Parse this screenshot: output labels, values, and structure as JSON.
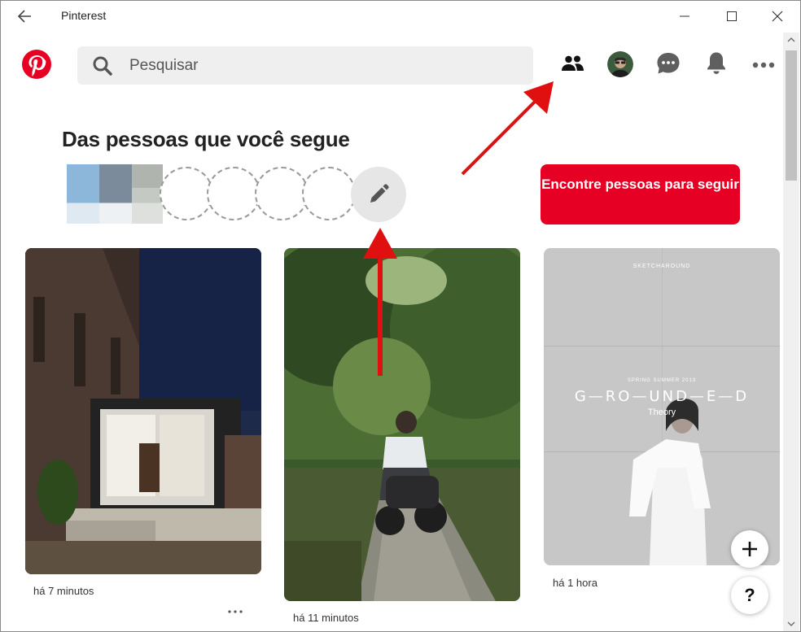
{
  "window": {
    "title": "Pinterest"
  },
  "header": {
    "search_placeholder": "Pesquisar",
    "icons": [
      "pinterest-logo-icon",
      "search-icon",
      "people-icon",
      "avatar",
      "chat-icon",
      "bell-icon",
      "more-icon"
    ]
  },
  "following": {
    "title": "Das pessoas que você segue",
    "find_people_button": "Encontre pessoas para seguir"
  },
  "pins": [
    {
      "time": "há 7 minutos"
    },
    {
      "time": "há 11 minutos"
    },
    {
      "time": "há 1 hora",
      "image_text": {
        "top": "SKETCHAROUND",
        "season": "SPRING SUMMER 2013",
        "brand": "G—RO—UND—E—D",
        "sub": "Theory"
      }
    }
  ],
  "fab": {
    "help_label": "?"
  },
  "colors": {
    "brand_red": "#e60023",
    "annotation_red": "#e01010"
  }
}
